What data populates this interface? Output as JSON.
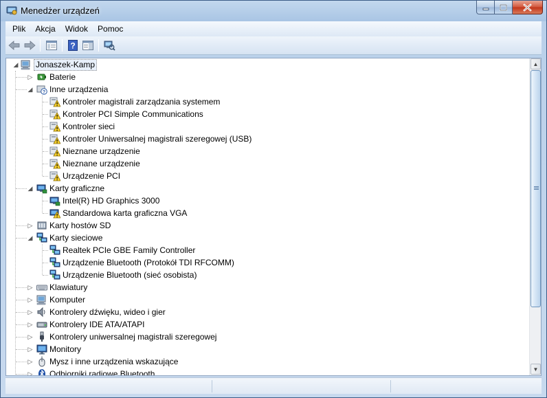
{
  "window": {
    "title": "Menedżer urządzeń"
  },
  "menu": [
    {
      "label": "Plik"
    },
    {
      "label": "Akcja"
    },
    {
      "label": "Widok"
    },
    {
      "label": "Pomoc"
    }
  ],
  "toolbar": [
    {
      "icon": "back-arrow-icon"
    },
    {
      "icon": "forward-arrow-icon"
    },
    {
      "icon": "properties-view-icon"
    },
    {
      "icon": "help-icon"
    },
    {
      "icon": "action-pane-icon"
    },
    {
      "icon": "scan-hardware-icon"
    }
  ],
  "tree": {
    "root": {
      "label": "Jonaszek-Kamp",
      "icon": "computer-icon"
    },
    "items": [
      {
        "label": "Baterie",
        "level": 1,
        "expander": "collapsed",
        "icon": "battery-icon"
      },
      {
        "label": "Inne urządzenia",
        "level": 1,
        "expander": "expanded",
        "icon": "unknown-device-icon"
      },
      {
        "label": "Kontroler magistrali zarządzania systemem",
        "level": 2,
        "expander": "none",
        "icon": "warning-device-icon"
      },
      {
        "label": "Kontroler PCI Simple Communications",
        "level": 2,
        "expander": "none",
        "icon": "warning-device-icon"
      },
      {
        "label": "Kontroler sieci",
        "level": 2,
        "expander": "none",
        "icon": "warning-device-icon"
      },
      {
        "label": "Kontroler Uniwersalnej magistrali szeregowej (USB)",
        "level": 2,
        "expander": "none",
        "icon": "warning-device-icon"
      },
      {
        "label": "Nieznane urządzenie",
        "level": 2,
        "expander": "none",
        "icon": "warning-device-icon"
      },
      {
        "label": "Nieznane urządzenie",
        "level": 2,
        "expander": "none",
        "icon": "warning-device-icon"
      },
      {
        "label": "Urządzenie PCI",
        "level": 2,
        "expander": "none",
        "icon": "warning-device-icon"
      },
      {
        "label": "Karty graficzne",
        "level": 1,
        "expander": "expanded",
        "icon": "display-adapter-icon"
      },
      {
        "label": "Intel(R) HD Graphics 3000",
        "level": 2,
        "expander": "none",
        "icon": "display-adapter-icon"
      },
      {
        "label": "Standardowa karta graficzna VGA",
        "level": 2,
        "expander": "none",
        "icon": "display-adapter-warning-icon"
      },
      {
        "label": "Karty hostów SD",
        "level": 1,
        "expander": "collapsed",
        "icon": "sd-host-icon"
      },
      {
        "label": "Karty sieciowe",
        "level": 1,
        "expander": "expanded",
        "icon": "network-adapter-icon"
      },
      {
        "label": "Realtek PCIe GBE Family Controller",
        "level": 2,
        "expander": "none",
        "icon": "network-adapter-icon"
      },
      {
        "label": "Urządzenie Bluetooth (Protokół TDI RFCOMM)",
        "level": 2,
        "expander": "none",
        "icon": "network-adapter-icon"
      },
      {
        "label": "Urządzenie Bluetooth (sieć osobista)",
        "level": 2,
        "expander": "none",
        "icon": "network-adapter-icon"
      },
      {
        "label": "Klawiatury",
        "level": 1,
        "expander": "collapsed",
        "icon": "keyboard-icon"
      },
      {
        "label": "Komputer",
        "level": 1,
        "expander": "collapsed",
        "icon": "computer-icon"
      },
      {
        "label": "Kontrolery dźwięku, wideo i gier",
        "level": 1,
        "expander": "collapsed",
        "icon": "speaker-icon"
      },
      {
        "label": "Kontrolery IDE ATA/ATAPI",
        "level": 1,
        "expander": "collapsed",
        "icon": "ide-controller-icon"
      },
      {
        "label": "Kontrolery uniwersalnej magistrali szeregowej",
        "level": 1,
        "expander": "collapsed",
        "icon": "usb-icon"
      },
      {
        "label": "Monitory",
        "level": 1,
        "expander": "collapsed",
        "icon": "monitor-icon"
      },
      {
        "label": "Mysz i inne urządzenia wskazujące",
        "level": 1,
        "expander": "collapsed",
        "icon": "mouse-icon"
      },
      {
        "label": "Odbiorniki radiowe Bluetooth",
        "level": 1,
        "expander": "collapsed",
        "icon": "bluetooth-icon"
      }
    ]
  }
}
